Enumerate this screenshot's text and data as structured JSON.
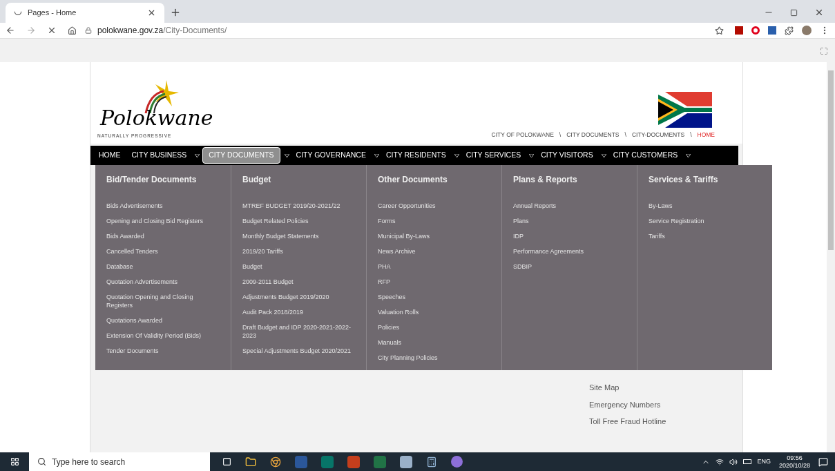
{
  "browser": {
    "tab_title": "Pages - Home",
    "url_domain": "polokwane.gov.za",
    "url_path": "/City-Documents/"
  },
  "logo": {
    "name": "Polokwane",
    "tagline": "NATURALLY PROGRESSIVE"
  },
  "breadcrumb": [
    {
      "label": "CITY OF POLOKWANE",
      "current": false
    },
    {
      "label": "CITY DOCUMENTS",
      "current": false
    },
    {
      "label": "CITY-DOCUMENTS",
      "current": false
    },
    {
      "label": "HOME",
      "current": true
    }
  ],
  "breadcrumb_separator": "\\",
  "nav": [
    {
      "label": "HOME",
      "selected": false,
      "has_menu": false
    },
    {
      "label": "CITY BUSINESS",
      "selected": false,
      "has_menu": true
    },
    {
      "label": "CITY DOCUMENTS",
      "selected": true,
      "has_menu": true
    },
    {
      "label": "CITY GOVERNANCE",
      "selected": false,
      "has_menu": true
    },
    {
      "label": "CITY RESIDENTS",
      "selected": false,
      "has_menu": true
    },
    {
      "label": "CITY SERVICES",
      "selected": false,
      "has_menu": true
    },
    {
      "label": "CITY VISITORS",
      "selected": false,
      "has_menu": true
    },
    {
      "label": "CITY CUSTOMERS",
      "selected": false,
      "has_menu": true
    }
  ],
  "menu_columns": [
    {
      "heading": "Bid/Tender Documents",
      "items": [
        "Bids Advertisements",
        "Opening and Closing Bid Registers",
        "Bids Awarded",
        "Cancelled Tenders",
        "Database",
        "Quotation Advertisements",
        "Quotation Opening and Closing Registers",
        "Quotations Awarded",
        "Extension Of Validity Period (Bids)",
        "Tender Documents"
      ]
    },
    {
      "heading": "Budget",
      "items": [
        "MTREF BUDGET 2019/20-2021/22",
        "Budget Related Policies",
        "Monthly Budget Statements",
        "2019/20 Tariffs",
        "Budget",
        "2009-2011 Budget",
        "Adjustments Budget 2019/2020",
        "Audit Pack 2018/2019",
        "Draft Budget and IDP 2020-2021-2022-2023",
        "Special Adjustments Budget 2020/2021"
      ]
    },
    {
      "heading": "Other Documents",
      "items": [
        "Career Opportunities",
        "Forms",
        "Municipal By-Laws",
        "News Archive",
        "PHA",
        "RFP",
        "Speeches",
        "Valuation Rolls",
        "Policies",
        "Manuals",
        "City Planning Policies"
      ]
    },
    {
      "heading": "Plans & Reports",
      "items": [
        "Annual Reports",
        "Plans",
        "IDP",
        "Performance Agreements",
        "SDBIP"
      ]
    },
    {
      "heading": "Services & Tariffs",
      "items": [
        "By-Laws",
        "Service Registration",
        "Tariffs"
      ]
    }
  ],
  "footer_links": [
    "Site Map",
    "Emergency Numbers",
    "Toll Free Fraud Hotline"
  ],
  "taskbar": {
    "search_placeholder": "Type here to search",
    "language": "ENG",
    "time": "09:56",
    "date": "2020/10/28"
  }
}
